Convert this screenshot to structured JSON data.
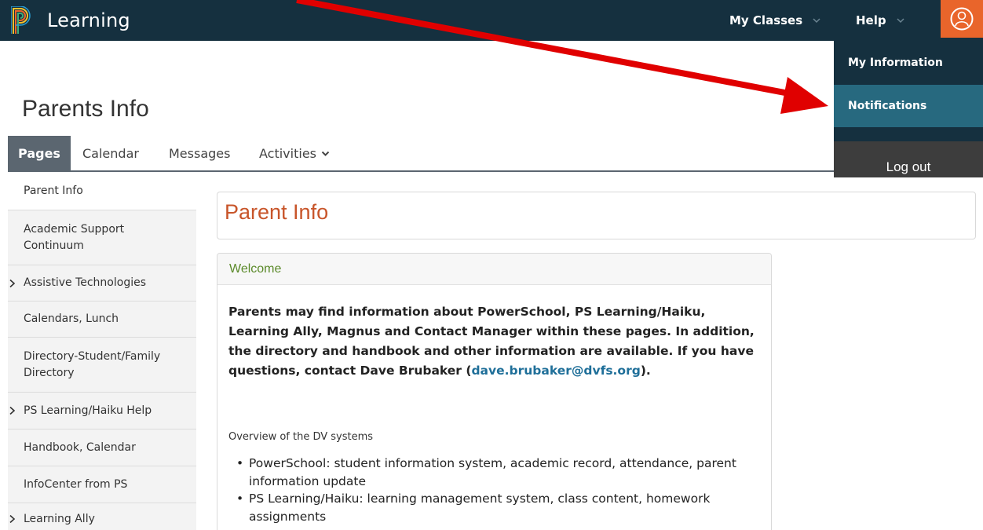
{
  "navbar": {
    "brand_name": "Learning",
    "my_classes": "My Classes",
    "help": "Help"
  },
  "dropdown": {
    "my_information": "My Information",
    "notifications": "Notifications",
    "log_out": "Log out"
  },
  "page": {
    "title": "Parents Info"
  },
  "tabs": [
    {
      "label": "Pages"
    },
    {
      "label": "Calendar"
    },
    {
      "label": "Messages"
    },
    {
      "label": "Activities"
    }
  ],
  "sidebar": {
    "items": [
      {
        "label": "Parent Info"
      },
      {
        "label": "Academic Support Continuum"
      },
      {
        "label": "Assistive Technologies"
      },
      {
        "label": "Calendars, Lunch"
      },
      {
        "label": "Directory-Student/Family Directory"
      },
      {
        "label": "PS Learning/Haiku Help"
      },
      {
        "label": "Handbook, Calendar"
      },
      {
        "label": "InfoCenter from PS"
      },
      {
        "label": "Learning Ally"
      }
    ]
  },
  "content": {
    "title": "Parent Info",
    "welcome": {
      "heading": "Welcome",
      "intro": "Parents may find information about PowerSchool, PS Learning/Haiku, Learning Ally, Magnus and Contact Manager within these pages.  In addition, the directory and handbook and other information are available.  If you have questions, contact Dave Brubaker (",
      "email": "dave.brubaker@dvfs.org",
      "intro_end": ").",
      "overview": "Overview of the DV systems",
      "bullets": [
        "PowerSchool: student information system, academic record, attendance, parent information update",
        "PS Learning/Haiku: learning management system, class content, homework assignments"
      ]
    }
  },
  "colors": {
    "navbar": "#15303f",
    "accent_orange": "#e9652b",
    "dropdown_highlight": "#27697f",
    "content_title": "#c8552a",
    "welcome_title": "#5b8a2a",
    "link": "#1f6f99",
    "annotation_arrow": "#e00000"
  }
}
